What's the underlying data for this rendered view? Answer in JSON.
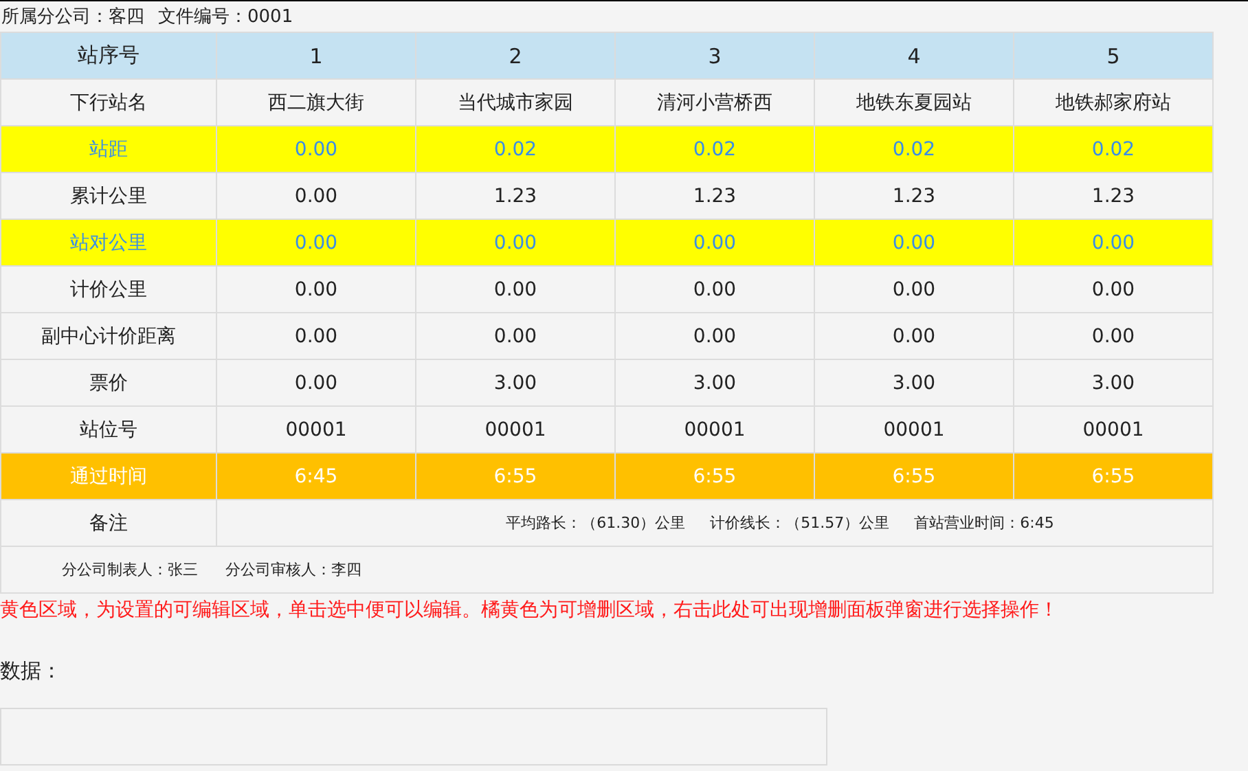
{
  "meta": [
    {
      "label": "所属分公司：",
      "value": "客四"
    },
    {
      "label": "文件编号：",
      "value": "0001"
    }
  ],
  "rows": [
    {
      "kind": "header",
      "label": "站序号",
      "cells": [
        "1",
        "2",
        "3",
        "4",
        "5"
      ]
    },
    {
      "kind": "plain",
      "label": "下行站名",
      "cells": [
        "西二旗大街",
        "当代城市家园",
        "清河小营桥西",
        "地铁东夏园站",
        "地铁郝家府站"
      ]
    },
    {
      "kind": "editable",
      "label": "站距",
      "cells": [
        "0.00",
        "0.02",
        "0.02",
        "0.02",
        "0.02"
      ]
    },
    {
      "kind": "plain",
      "label": "累计公里",
      "cells": [
        "0.00",
        "1.23",
        "1.23",
        "1.23",
        "1.23"
      ]
    },
    {
      "kind": "editable",
      "label": "站对公里",
      "cells": [
        "0.00",
        "0.00",
        "0.00",
        "0.00",
        "0.00"
      ]
    },
    {
      "kind": "plain",
      "label": "计价公里",
      "cells": [
        "0.00",
        "0.00",
        "0.00",
        "0.00",
        "0.00"
      ]
    },
    {
      "kind": "plain",
      "label": "副中心计价距离",
      "cells": [
        "0.00",
        "0.00",
        "0.00",
        "0.00",
        "0.00"
      ]
    },
    {
      "kind": "plain",
      "label": "票价",
      "cells": [
        "0.00",
        "3.00",
        "3.00",
        "3.00",
        "3.00"
      ]
    },
    {
      "kind": "plain",
      "label": "站位号",
      "cells": [
        "00001",
        "00001",
        "00001",
        "00001",
        "00001"
      ]
    },
    {
      "kind": "addable",
      "label": "通过时间",
      "cells": [
        "6:45",
        "6:55",
        "6:55",
        "6:55",
        "6:55"
      ]
    }
  ],
  "remarks": {
    "label": "备注",
    "items": [
      "平均路长：（61.30）公里",
      "计价线长：（51.57）公里",
      "首站营业时间：6:45"
    ]
  },
  "signoff": [
    "分公司制表人：张三",
    "分公司审核人：李四"
  ],
  "notice": "黄色区域，为设置的可编辑区域，单击选中便可以编辑。橘黄色为可增删区域，右击此处可出现增删面板弹窗进行选择操作！",
  "data_field": {
    "label": "数据："
  }
}
